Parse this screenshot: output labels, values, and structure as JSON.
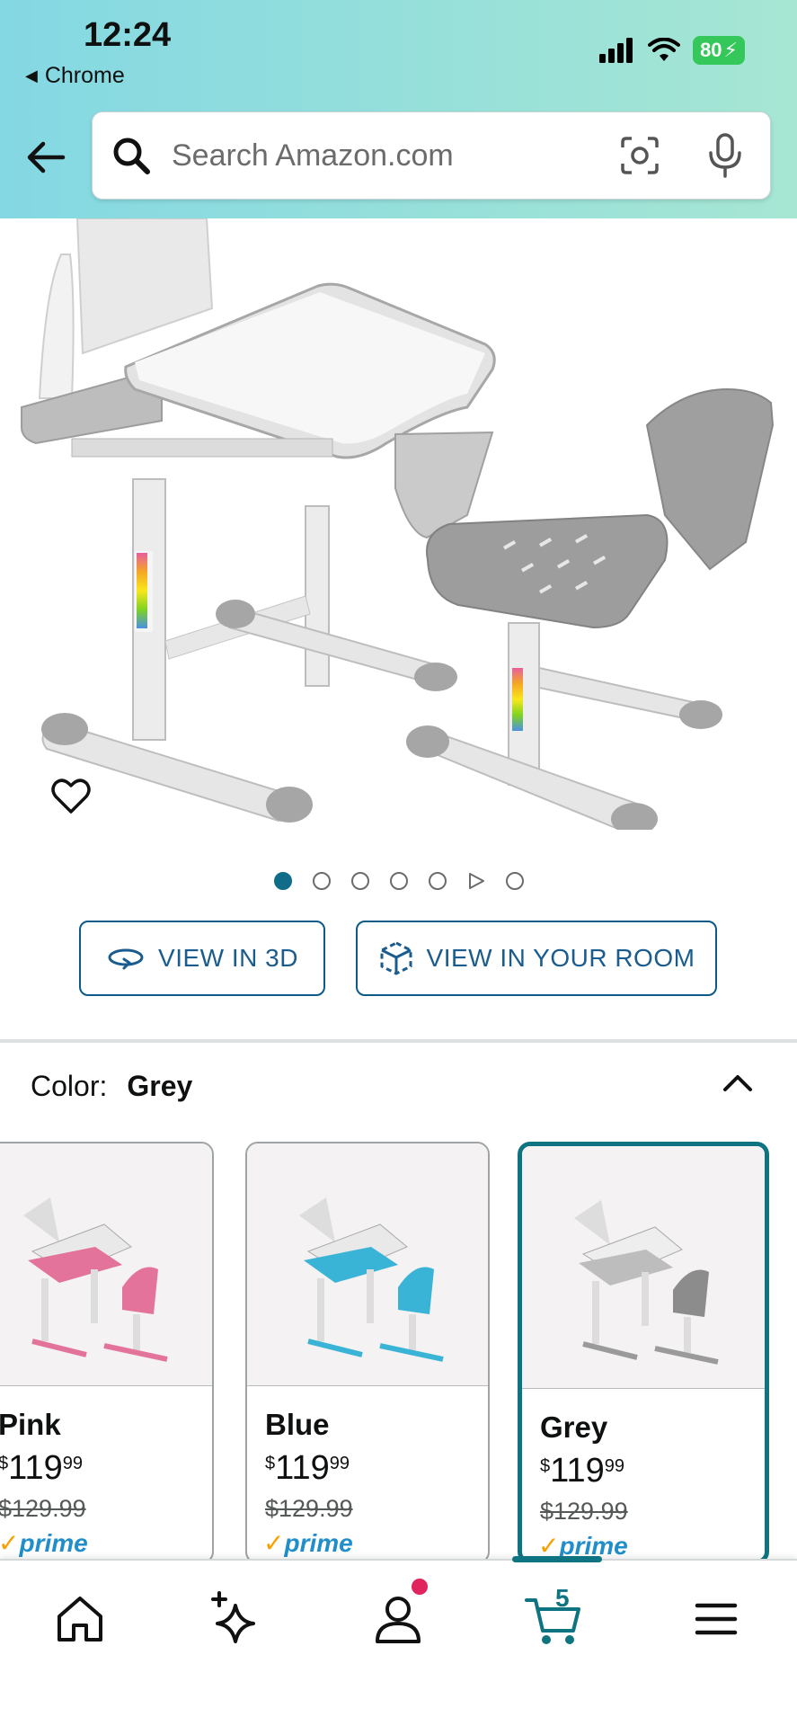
{
  "status_bar": {
    "time": "12:24",
    "back_app": "Chrome",
    "battery": "80"
  },
  "search": {
    "placeholder": "Search Amazon.com"
  },
  "product": {
    "carousel_dots": 7,
    "active_dot": 1,
    "buttons": {
      "view_3d": "VIEW IN 3D",
      "view_room": "VIEW IN YOUR ROOM"
    }
  },
  "color_selector": {
    "label": "Color:",
    "selected": "Grey",
    "options": [
      {
        "name": "Pink",
        "price_whole": "119",
        "price_cents": "99",
        "currency": "$",
        "old_price": "$129.99",
        "prime": "prime",
        "color": "#e4739b"
      },
      {
        "name": "Blue",
        "price_whole": "119",
        "price_cents": "99",
        "currency": "$",
        "old_price": "$129.99",
        "prime": "prime",
        "color": "#3ab4d6"
      },
      {
        "name": "Grey",
        "price_whole": "119",
        "price_cents": "99",
        "currency": "$",
        "old_price": "$129.99",
        "prime": "prime",
        "color": "#8c8c8c"
      }
    ]
  },
  "bottom_nav": {
    "cart_count": "5"
  },
  "colors": {
    "accent": "#0f7482",
    "link": "#1a5c8e",
    "prime": "#1f8ecb"
  }
}
